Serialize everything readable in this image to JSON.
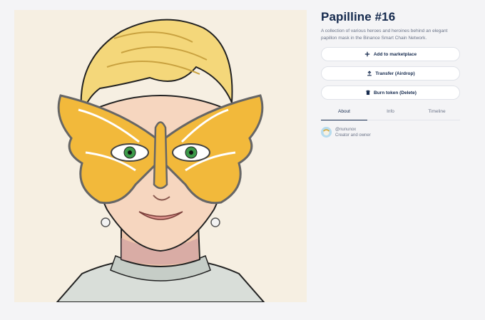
{
  "nft": {
    "title": "Papilline #16",
    "description": "A collection of various heroes and heroines behind an elegant papillon mask in the Binance Smart Chain Network."
  },
  "actions": {
    "add_label": "Add to marketplace",
    "add_icon": "plus-icon",
    "transfer_label": "Transfer (Airdrop)",
    "transfer_icon": "upload-icon",
    "burn_label": "Burn token (Delete)",
    "burn_icon": "trash-icon"
  },
  "tabs": [
    "About",
    "Info",
    "Timeline"
  ],
  "active_tab": "About",
  "owner": {
    "handle": "@nununox",
    "role": "Creator and owner"
  },
  "colors": {
    "title": "#14294d",
    "muted_text": "#6b7488",
    "artwork_bg": "#f6efe2",
    "mask_gold": "#f2b93b",
    "hair_blonde": "#f4d77a"
  }
}
